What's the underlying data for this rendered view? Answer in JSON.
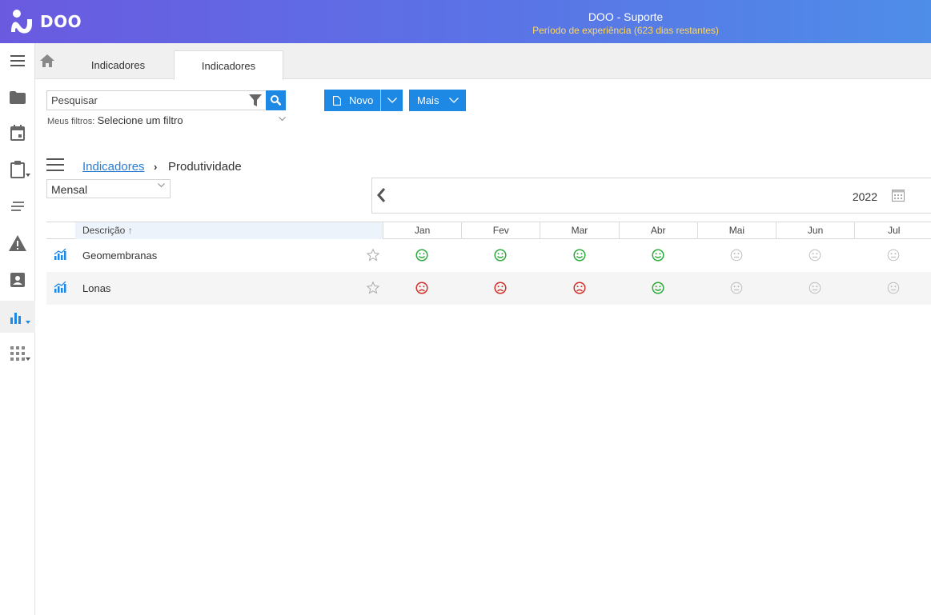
{
  "header": {
    "brand": "DOO",
    "title": "DOO - Suporte",
    "subtitle": "Período de experiência (623 dias restantes)",
    "accent": "#ffd860"
  },
  "sidebar": {
    "items": [
      {
        "icon": "menu-icon"
      },
      {
        "icon": "folder-icon"
      },
      {
        "icon": "calendar-icon"
      },
      {
        "icon": "clipboard-icon"
      },
      {
        "icon": "list-icon"
      },
      {
        "icon": "warning-icon"
      },
      {
        "icon": "contact-icon"
      },
      {
        "icon": "bar-chart-icon",
        "active": true
      },
      {
        "icon": "apps-grid-icon"
      }
    ]
  },
  "tabs": [
    {
      "label": "Indicadores",
      "active": false
    },
    {
      "label": "Indicadores",
      "active": true
    }
  ],
  "search": {
    "placeholder": "Pesquisar",
    "value": ""
  },
  "filters": {
    "label": "Meus filtros:",
    "value": "Selecione um filtro"
  },
  "buttons": {
    "novo": "Novo",
    "mais": "Mais"
  },
  "breadcrumb": {
    "parent": "Indicadores",
    "current": "Produtividade"
  },
  "period": {
    "selected": "Mensal"
  },
  "year": "2022",
  "table": {
    "desc_header": "Descrição",
    "months": [
      "Jan",
      "Fev",
      "Mar",
      "Abr",
      "Mai",
      "Jun",
      "Jul"
    ],
    "rows": [
      {
        "name": "Geomembranas",
        "status": [
          "good",
          "good",
          "good",
          "good",
          "neutral",
          "neutral",
          "neutral"
        ]
      },
      {
        "name": "Lonas",
        "status": [
          "bad",
          "bad",
          "bad",
          "good",
          "neutral",
          "neutral",
          "neutral"
        ]
      }
    ]
  },
  "colors": {
    "good": "#2eaa3c",
    "bad": "#d0302a",
    "neutral": "#bdbdbd",
    "primary": "#1e88e5"
  }
}
